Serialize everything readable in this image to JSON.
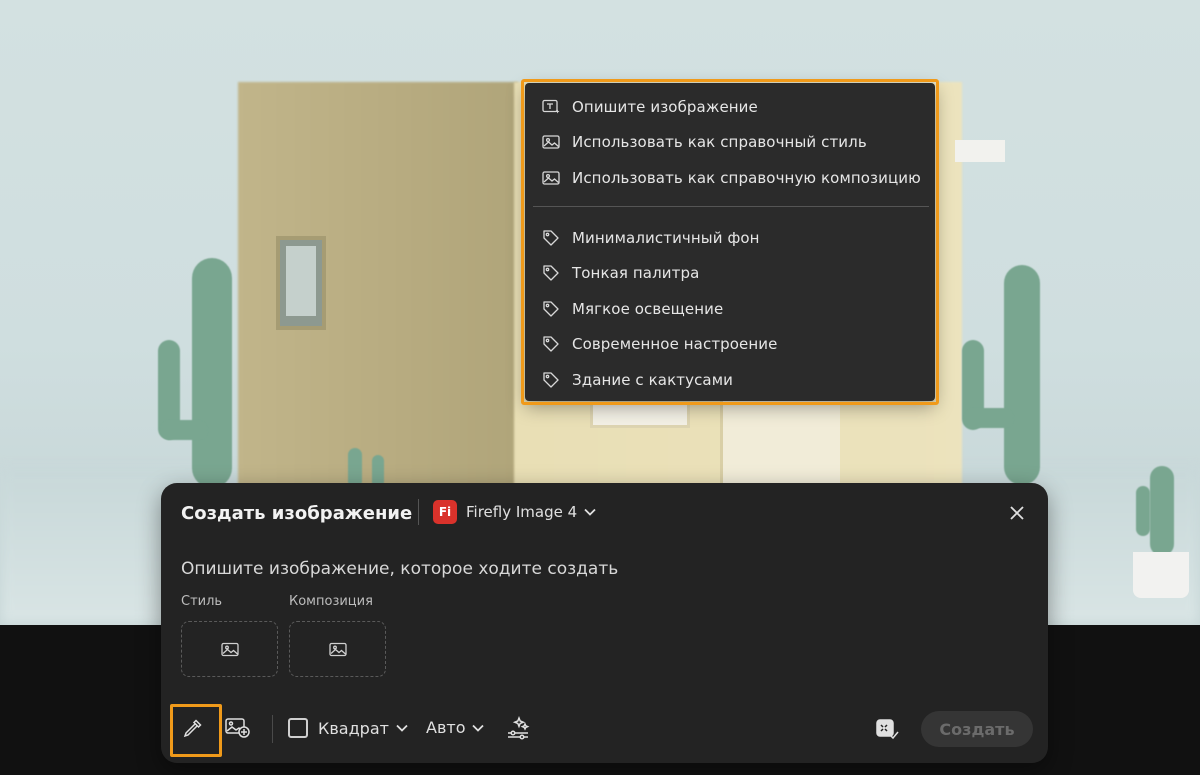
{
  "menu": {
    "actions": [
      {
        "label": "Опишите изображение",
        "icon": "text-sparkle-icon"
      },
      {
        "label": "Использовать как справочный стиль",
        "icon": "image-icon"
      },
      {
        "label": "Использовать как справочную композицию",
        "icon": "image-icon"
      }
    ],
    "tags": [
      {
        "label": "Минималистичный фон",
        "icon": "tag-icon"
      },
      {
        "label": "Тонкая палитра",
        "icon": "tag-icon"
      },
      {
        "label": "Мягкое освещение",
        "icon": "tag-icon"
      },
      {
        "label": "Современное настроение",
        "icon": "tag-icon"
      },
      {
        "label": "Здание с кактусами",
        "icon": "tag-icon"
      }
    ]
  },
  "panel": {
    "title": "Создать изображение",
    "model_logo": "Fi",
    "model_name": "Firefly Image 4",
    "prompt_placeholder": "Опишите изображение, которое ходите создать",
    "style_label": "Стиль",
    "composition_label": "Композиция",
    "aspect_label": "Квадрат",
    "content_type_label": "Авто",
    "create_label": "Создать"
  },
  "colors": {
    "highlight": "#f09a1a",
    "panel_bg": "#232323",
    "menu_bg": "#2b2b2b",
    "firefly_red": "#d9322b"
  }
}
